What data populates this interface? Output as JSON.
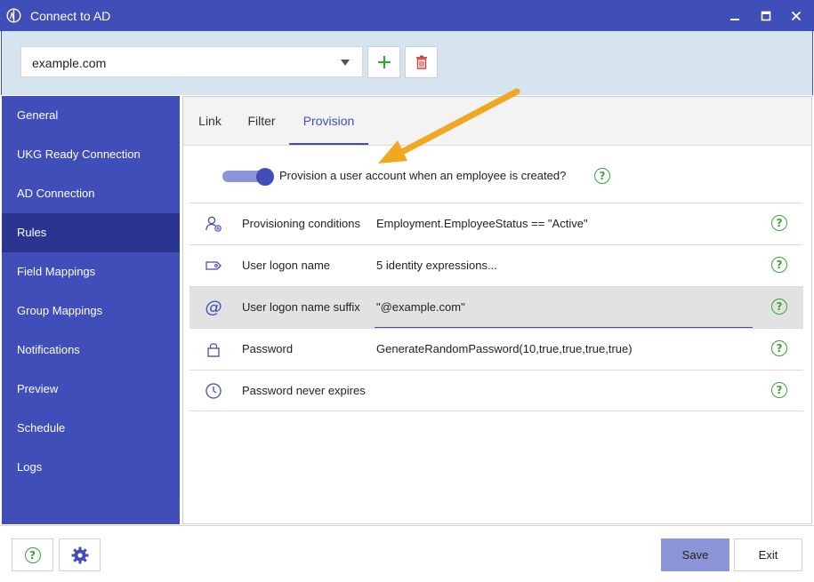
{
  "window": {
    "title": "Connect to AD"
  },
  "domain": {
    "selected": "example.com"
  },
  "sidebar": {
    "items": [
      {
        "label": "General"
      },
      {
        "label": "UKG Ready Connection"
      },
      {
        "label": "AD Connection"
      },
      {
        "label": "Rules",
        "active": true
      },
      {
        "label": "Field Mappings"
      },
      {
        "label": "Group Mappings"
      },
      {
        "label": "Notifications"
      },
      {
        "label": "Preview"
      },
      {
        "label": "Schedule"
      },
      {
        "label": "Logs"
      }
    ]
  },
  "tabs": [
    {
      "label": "Link"
    },
    {
      "label": "Filter"
    },
    {
      "label": "Provision",
      "active": true
    }
  ],
  "provision": {
    "toggle_label": "Provision a user account when an employee is created?",
    "toggle_on": true
  },
  "rules": [
    {
      "icon": "user-add-icon",
      "label": "Provisioning conditions",
      "value": "Employment.EmployeeStatus  ==  \"Active\""
    },
    {
      "icon": "tag-icon",
      "label": "User logon name",
      "value": "5 identity expressions..."
    },
    {
      "icon": "at-sign-icon",
      "label": "User logon name suffix",
      "value": "\"@example.com\"",
      "selected": true
    },
    {
      "icon": "lock-icon",
      "label": "Password",
      "value": "GenerateRandomPassword(10,true,true,true,true)"
    },
    {
      "icon": "clock-icon",
      "label": "Password never expires",
      "value": ""
    }
  ],
  "help_glyph": "?",
  "footer": {
    "save_label": "Save",
    "exit_label": "Exit"
  },
  "colors": {
    "accent": "#3f4eb8",
    "accent_dark": "#2b3590",
    "help_green": "#3aa33a",
    "arrow_orange": "#f0a820"
  }
}
